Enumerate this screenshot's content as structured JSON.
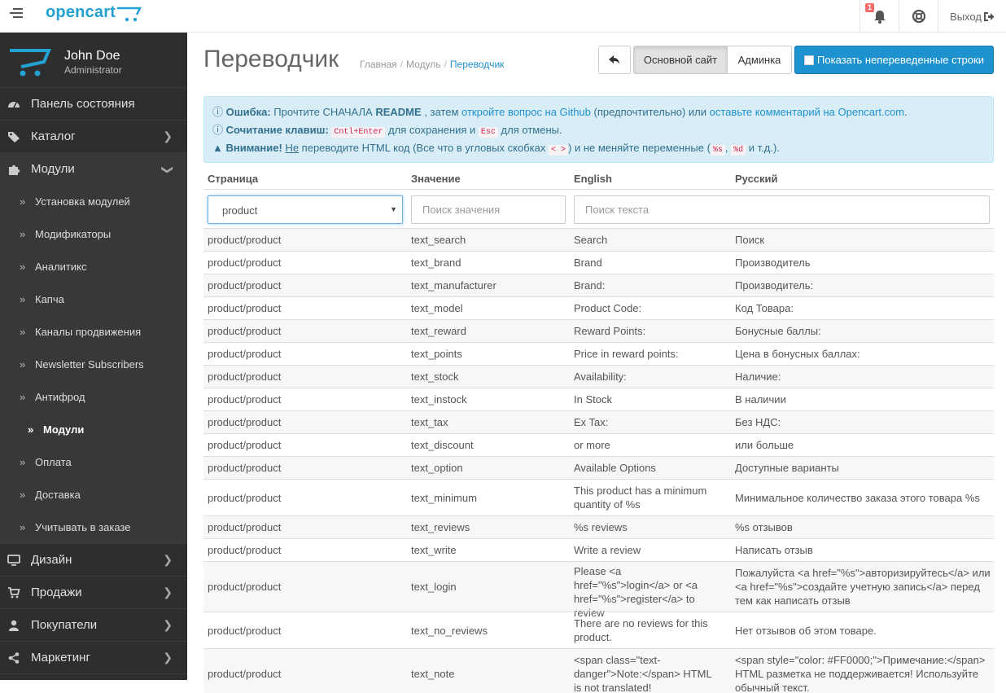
{
  "header": {
    "logo_text": "opencart",
    "notification_count": "1",
    "logout_label": "Выход"
  },
  "profile": {
    "name": "John Doe",
    "role": "Administrator"
  },
  "sidebar": {
    "top_items": [
      {
        "label": "Панель состояния",
        "icon": "dashboard-icon"
      },
      {
        "label": "Каталог",
        "icon": "tag-icon"
      },
      {
        "label": "Модули",
        "icon": "puzzle-icon"
      }
    ],
    "sub_items": [
      "Установка модулей",
      "Модификаторы",
      "Аналитикс",
      "Капча",
      "Каналы продвижения",
      "Newsletter Subscribers",
      "Антифрод",
      "Модули",
      "Оплата",
      "Доставка",
      "Учитывать в заказе"
    ],
    "bottom_items": [
      {
        "label": "Дизайн",
        "icon": "desktop-icon"
      },
      {
        "label": "Продажи",
        "icon": "cart-icon"
      },
      {
        "label": "Покупатели",
        "icon": "user-icon"
      },
      {
        "label": "Маркетинг",
        "icon": "share-icon"
      }
    ]
  },
  "page": {
    "title": "Переводчик",
    "breadcrumb": [
      "Главная",
      "Модуль",
      "Переводчик"
    ]
  },
  "toolbar": {
    "site_label": "Основной сайт",
    "admin_label": "Админка",
    "show_untranslated_label": "Показать непереведенные строки"
  },
  "alert": {
    "l1_b": "Ошибка:",
    "l1_t1": " Прочтите СНАЧАЛА ",
    "l1_readme": "README",
    "l1_t2": " , затем ",
    "l1_link1": "откройте вопрос на Github",
    "l1_t3": " (предпочтительно) или ",
    "l1_link2": "оставьте комментарий на Opencart.com",
    "l1_t4": ".",
    "l2_b": "Сочитание клавиш:",
    "l2_code1": "Cntl+Enter",
    "l2_t1": " для сохранения и ",
    "l2_code2": "Esc",
    "l2_t2": " для отмены.",
    "l3_b": "Внимание!",
    "l3_u": "Не",
    "l3_t1": " переводите HTML код (Все что в угловых скобках ",
    "l3_code1": "< >",
    "l3_t2": ") и не меняйте переменные (",
    "l3_code2": "%s",
    "l3_t3": ", ",
    "l3_code3": "%d",
    "l3_t4": " и т.д.)."
  },
  "table": {
    "headers": [
      "Страница",
      "Значение",
      "English",
      "Русский"
    ],
    "filter_page_value": "product",
    "value_placeholder": "Поиск значения",
    "text_placeholder": "Поиск текста",
    "rows": [
      [
        "product/product",
        "text_search",
        "Search",
        "Поиск"
      ],
      [
        "product/product",
        "text_brand",
        "Brand",
        "Производитель"
      ],
      [
        "product/product",
        "text_manufacturer",
        "Brand:",
        "Производитель:"
      ],
      [
        "product/product",
        "text_model",
        "Product Code:",
        "Код Товара:"
      ],
      [
        "product/product",
        "text_reward",
        "Reward Points:",
        "Бонусные баллы:"
      ],
      [
        "product/product",
        "text_points",
        "Price in reward points:",
        "Цена в бонусных баллах:"
      ],
      [
        "product/product",
        "text_stock",
        "Availability:",
        "Наличие:"
      ],
      [
        "product/product",
        "text_instock",
        "In Stock",
        "В наличии"
      ],
      [
        "product/product",
        "text_tax",
        "Ex Tax:",
        "Без НДС:"
      ],
      [
        "product/product",
        "text_discount",
        "or more",
        "или больше"
      ],
      [
        "product/product",
        "text_option",
        "Available Options",
        "Доступные варианты"
      ],
      [
        "product/product",
        "text_minimum",
        "This product has a minimum quantity of %s",
        "Минимальное количество заказа этого товара %s"
      ],
      [
        "product/product",
        "text_reviews",
        "%s reviews",
        "%s отзывов"
      ],
      [
        "product/product",
        "text_write",
        "Write a review",
        "Написать отзыв"
      ],
      [
        "product/product",
        "text_login",
        "Please <a href=\"%s\">login</a> or <a href=\"%s\">register</a> to review",
        "Пожалуйста <a href=\"%s\">авторизируйтесь</a> или <a href=\"%s\">создайте учетную запись</a> перед тем как написать отзыв"
      ],
      [
        "product/product",
        "text_no_reviews",
        "There are no reviews for this product.",
        "Нет отзывов об этом товаре."
      ],
      [
        "product/product",
        "text_note",
        "<span class=\"text-danger\">Note:</span> HTML is not translated!",
        "<span style=\"color: #FF0000;\">Примечание:</span> HTML разметка не поддерживается! Используйте обычный текст."
      ]
    ]
  }
}
